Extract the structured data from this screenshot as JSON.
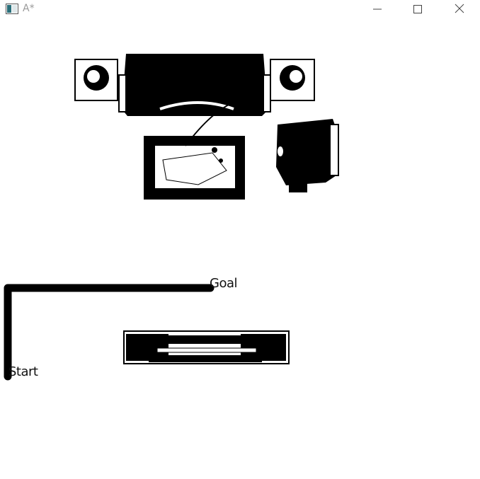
{
  "window": {
    "title": "A*"
  },
  "icons": {
    "app": "app-window-icon",
    "minimize": "minimize-icon",
    "maximize": "maximize-icon",
    "close": "close-icon"
  },
  "map": {
    "goal_label": "Goal",
    "start_label": "Start",
    "path_color": "#000000",
    "background_color": "#ffffff"
  }
}
